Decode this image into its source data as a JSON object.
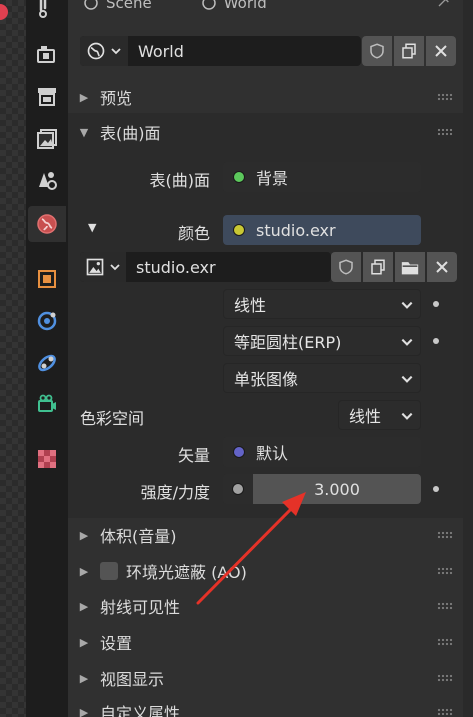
{
  "top_context": {
    "scene": "Scene",
    "world": "World"
  },
  "world_block": {
    "name": "World"
  },
  "sections": {
    "preview": "预览",
    "surface": "表(曲)面",
    "volume": "体积(音量)",
    "ao": "环境光遮蔽 (AO)",
    "ray_visibility": "射线可见性",
    "settings": "设置",
    "viewport_display": "视图显示",
    "custom_props": "自定义属性"
  },
  "surface_props": {
    "surface_label": "表(曲)面",
    "surface_value": "背景",
    "color_label": "颜色",
    "color_value": "studio.exr"
  },
  "image_block": {
    "name": "studio.exr"
  },
  "dropdowns": {
    "interpolation": "线性",
    "projection": "等距圆柱(ERP)",
    "source": "单张图像"
  },
  "colorspace": {
    "label": "色彩空间",
    "value": "线性"
  },
  "vector": {
    "label": "矢量",
    "value": "默认"
  },
  "strength": {
    "label": "强度/力度",
    "value": "3.000"
  },
  "colors": {
    "surface_socket": "#5cc85c",
    "color_socket": "#c8c834",
    "vector_socket": "#6363c7",
    "strength_socket": "#a1a1a1",
    "color_field_bg": "#3e4a5c",
    "annotation_arrow": "#e53228"
  },
  "icons": {
    "tabs": [
      "tool-icon",
      "render-icon",
      "output-icon",
      "view-layer-icon",
      "scene-icon",
      "world-icon",
      "object-icon",
      "modifier-icon",
      "physics-icon",
      "constraint-icon",
      "data-icon",
      "texture-icon"
    ]
  }
}
